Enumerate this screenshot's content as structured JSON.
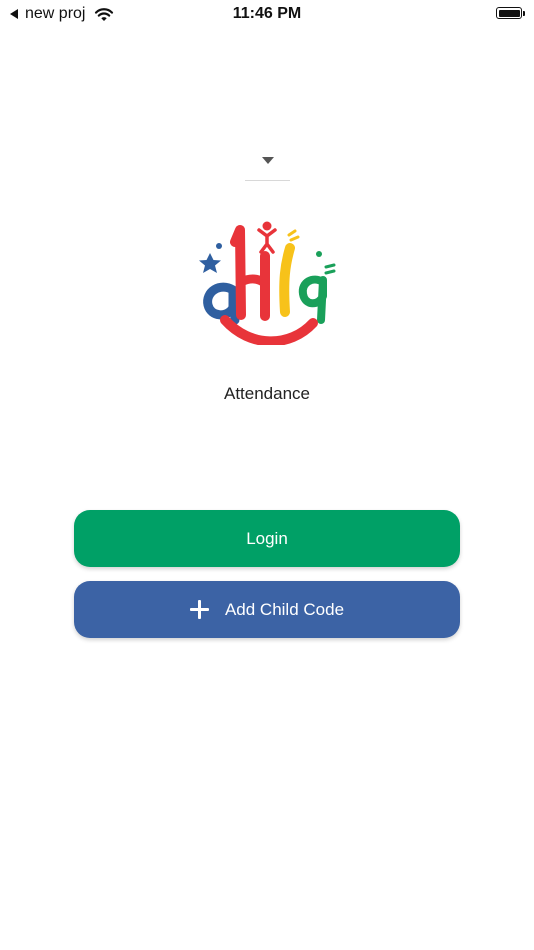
{
  "status_bar": {
    "back_label": "new proj",
    "time": "11:46 PM",
    "icons": [
      "back-arrow-icon",
      "wifi-icon",
      "battery-icon"
    ]
  },
  "language_dropdown": {
    "selected": "",
    "icon": "chevron-down-icon"
  },
  "logo": {
    "icon": "ahla-logo",
    "colors": {
      "red": "#e8343a",
      "blue": "#2f5fa0",
      "yellow": "#f7c21a",
      "green": "#1aa05a"
    }
  },
  "subtitle": "Attendance",
  "buttons": {
    "login_label": "Login",
    "add_child_label": "Add Child Code",
    "login_color": "#00a066",
    "add_child_color": "#3c63a5"
  }
}
